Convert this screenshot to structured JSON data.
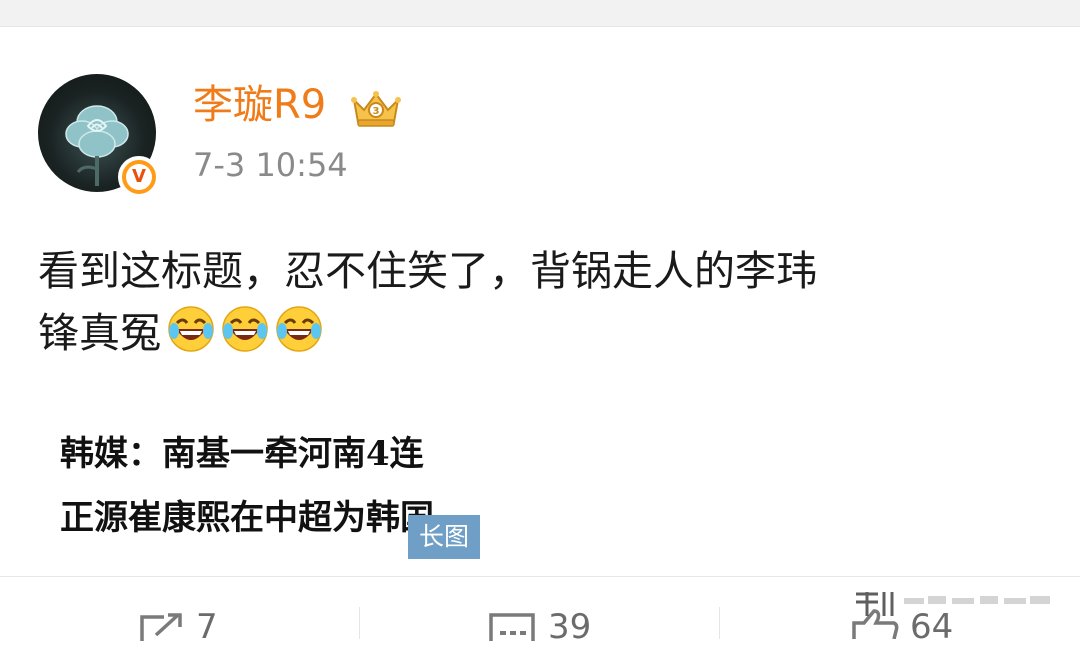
{
  "post": {
    "username": "李璇R9",
    "timestamp": "7-3 10:54",
    "text_line1": "看到这标题，忍不住笑了，背锅走人的李玮",
    "text_line2": "锋真冤",
    "emoji": [
      "laugh-cry-emoji",
      "laugh-cry-emoji",
      "laugh-cry-emoji"
    ]
  },
  "article_image": {
    "headline_line1": "韩媒：南基一牵河南4连",
    "headline_line2": "正源崔康熙在中超为韩国",
    "badge": "长图"
  },
  "actions": {
    "repost_count": "7",
    "comment_count": "39",
    "like_count": "64"
  },
  "colors": {
    "username": "#f07b19",
    "verified_badge": "#ff9b16",
    "long_image_badge": "#6f9fc6"
  }
}
